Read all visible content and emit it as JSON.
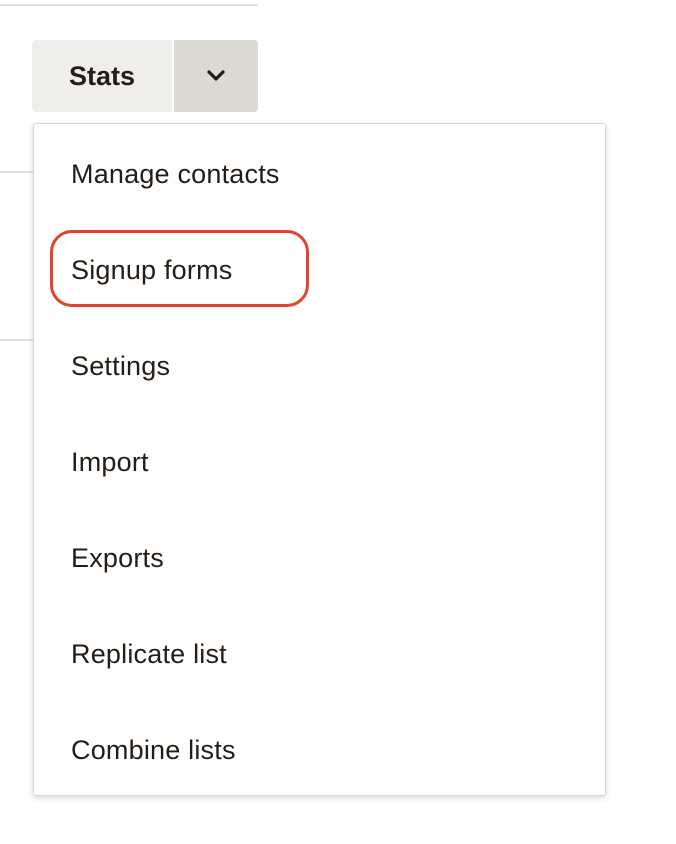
{
  "split_button": {
    "label": "Stats",
    "toggle_icon": "chevron-down-icon"
  },
  "menu": {
    "items": [
      {
        "label": "Manage contacts",
        "highlighted": false
      },
      {
        "label": "Signup forms",
        "highlighted": true
      },
      {
        "label": "Settings",
        "highlighted": false
      },
      {
        "label": "Import",
        "highlighted": false
      },
      {
        "label": "Exports",
        "highlighted": false
      },
      {
        "label": "Replicate list",
        "highlighted": false
      },
      {
        "label": "Combine lists",
        "highlighted": false
      }
    ]
  },
  "colors": {
    "text": "#241c15",
    "button_main_bg": "#efeeea",
    "button_toggle_bg": "#dddad3",
    "highlight_ring": "#e0442a"
  }
}
